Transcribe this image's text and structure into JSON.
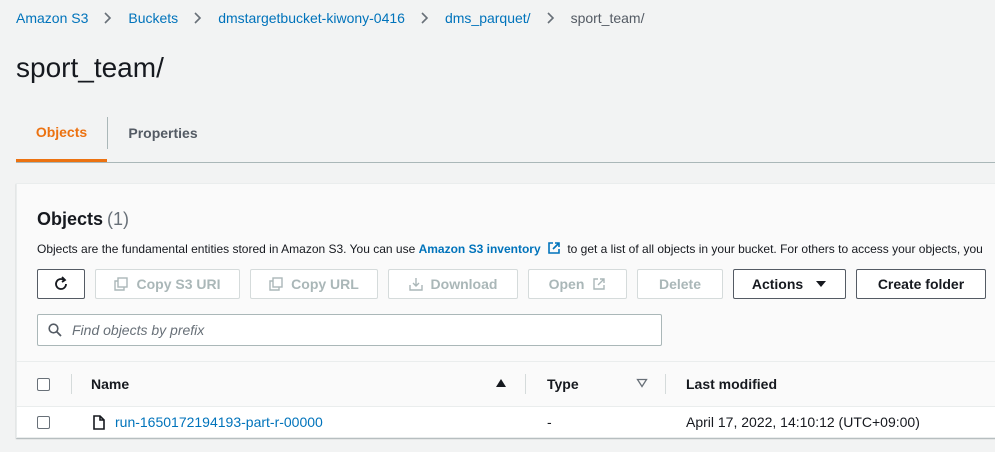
{
  "breadcrumb": {
    "items": [
      "Amazon S3",
      "Buckets",
      "dmstargetbucket-kiwony-0416",
      "dms_parquet/"
    ],
    "current": "sport_team/"
  },
  "page": {
    "title": "sport_team/"
  },
  "tabs": [
    {
      "label": "Objects",
      "active": true
    },
    {
      "label": "Properties",
      "active": false
    }
  ],
  "objects_panel": {
    "title": "Objects",
    "count": "(1)",
    "description_prefix": "Objects are the fundamental entities stored in Amazon S3. You can use",
    "inventory_link": "Amazon S3 inventory",
    "description_suffix": "to get a list of all objects in your bucket. For others to access your objects, you",
    "toolbar": {
      "refresh_icon": "refresh-icon",
      "copy_s3_uri": "Copy S3 URI",
      "copy_url": "Copy URL",
      "download": "Download",
      "open": "Open",
      "delete": "Delete",
      "actions": "Actions",
      "create_folder": "Create folder"
    },
    "search": {
      "placeholder": "Find objects by prefix",
      "value": ""
    },
    "columns": [
      "Name",
      "Type",
      "Last modified"
    ],
    "rows": [
      {
        "name": "run-1650172194193-part-r-00000",
        "type": "-",
        "last_modified": "April 17, 2022, 14:10:12 (UTC+09:00)"
      }
    ]
  },
  "colors": {
    "link": "#0073bb",
    "active_tab": "#ec7211",
    "text": "#16191f",
    "muted": "#545b64",
    "disabled": "#aab7b8",
    "background": "#f2f3f3"
  }
}
